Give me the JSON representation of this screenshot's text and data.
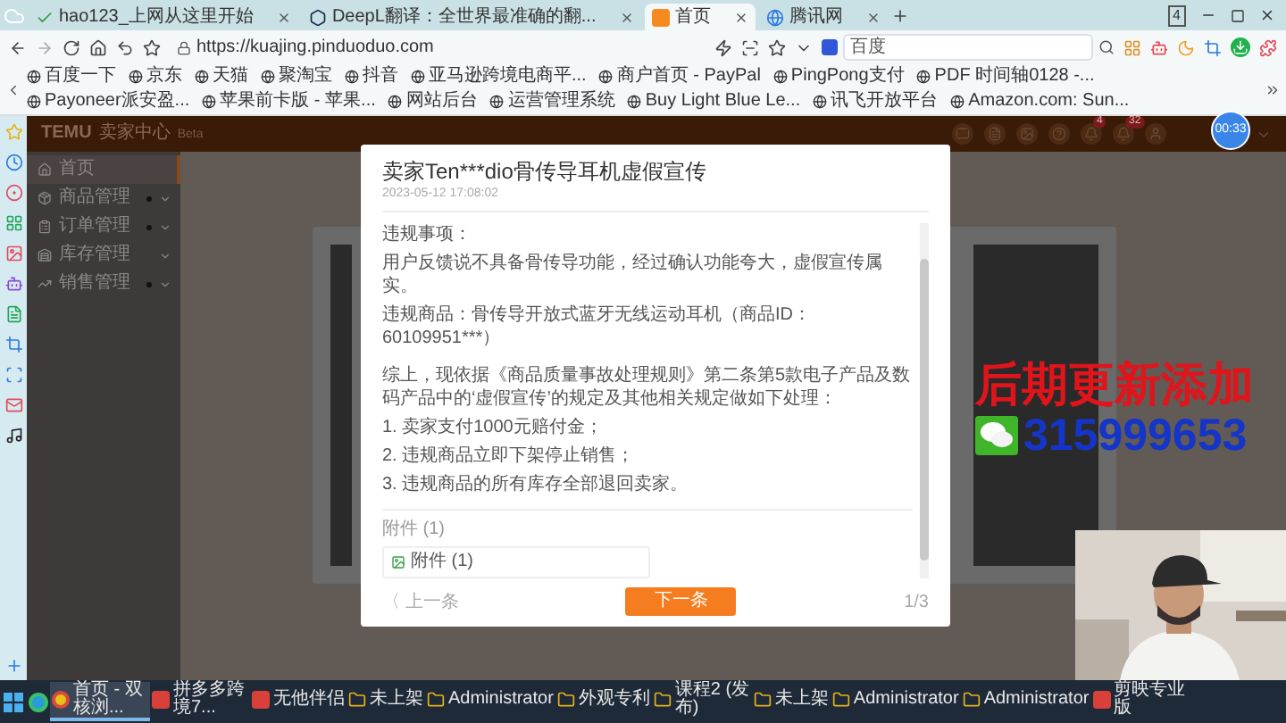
{
  "browser": {
    "tabs": [
      {
        "title": "hao123_上网从这里开始",
        "selected": false
      },
      {
        "title": "DeepL翻译：全世界最准确的翻...",
        "selected": false
      },
      {
        "title": "首页",
        "selected": true
      },
      {
        "title": "腾讯网",
        "selected": false
      }
    ],
    "window_count": "4",
    "url": "https://kuajing.pinduoduo.com",
    "search_placeholder": "百度",
    "bookmarks": [
      "百度一下",
      "京东",
      "天猫",
      "聚淘宝",
      "抖音",
      "亚马逊跨境电商平...",
      "商户首页 - PayPal",
      "PingPong支付",
      "PDF 时间轴0128 -...",
      "Payoneer派安盈...",
      "苹果前卡版 - 苹果...",
      "网站后台",
      "运营管理系统",
      "Buy Light Blue Le...",
      "讯飞开放平台",
      "Amazon.com: Sun..."
    ]
  },
  "app": {
    "logo": "TEMU",
    "subtitle": "卖家中心",
    "beta": "Beta",
    "notifications": [
      {
        "count": "4"
      },
      {
        "count": "32"
      }
    ],
    "sidebar": {
      "items": [
        {
          "label": "首页",
          "kind": "link",
          "selected": true,
          "dot": false
        },
        {
          "label": "商品管理",
          "kind": "group",
          "selected": false,
          "dot": true
        },
        {
          "label": "订单管理",
          "kind": "group",
          "selected": false,
          "dot": true
        },
        {
          "label": "库存管理",
          "kind": "group",
          "selected": false,
          "dot": false
        },
        {
          "label": "销售管理",
          "kind": "group",
          "selected": false,
          "dot": true
        }
      ]
    }
  },
  "recorder": {
    "time": "00:33"
  },
  "dialog": {
    "title": "卖家Ten***dio骨传导耳机虚假宣传",
    "date": "2023-05-12 17:08:02",
    "violation_heading": "违规事项：",
    "violation_detail": "用户反馈说不具备骨传导功能，经过确认功能夸大，虚假宣传属实。",
    "product": "违规商品：骨传导开放式蓝牙无线运动耳机（商品ID：60109951***）",
    "ruling": "综上，现依据《商品质量事故处理规则》第二条第5款电子产品及数码产品中的‘虚假宣传’的规定及其他相关规定做如下处理：",
    "penalties": [
      "1. 卖家支付1000元赔付金；",
      "2. 违规商品立即下架停止销售；",
      "3. 违规商品的所有库存全部退回卖家。"
    ],
    "attachments_heading": "附件 (1)",
    "attachment": "附件 (1)",
    "prev": "〈 上一条",
    "next": "下一条",
    "pager": "1/3"
  },
  "overlay": {
    "headline": "后期更新添加",
    "number": "315999653"
  },
  "taskbar": {
    "items": [
      {
        "label": "首页 - 双核浏...",
        "kind": "browser",
        "selected": true
      },
      {
        "label": "拼多多跨境7...",
        "kind": "app",
        "selected": false
      },
      {
        "label": "无他伴侣",
        "kind": "app",
        "selected": false
      },
      {
        "label": "未上架",
        "kind": "folder",
        "selected": false
      },
      {
        "label": "Administrator",
        "kind": "folder",
        "selected": false
      },
      {
        "label": "外观专利",
        "kind": "folder",
        "selected": false
      },
      {
        "label": "课程2 (发布)",
        "kind": "folder",
        "selected": false
      },
      {
        "label": "未上架",
        "kind": "folder",
        "selected": false
      },
      {
        "label": "Administrator",
        "kind": "folder",
        "selected": false
      },
      {
        "label": "Administrator",
        "kind": "folder",
        "selected": false
      },
      {
        "label": "剪映专业版",
        "kind": "app",
        "selected": false
      }
    ]
  }
}
